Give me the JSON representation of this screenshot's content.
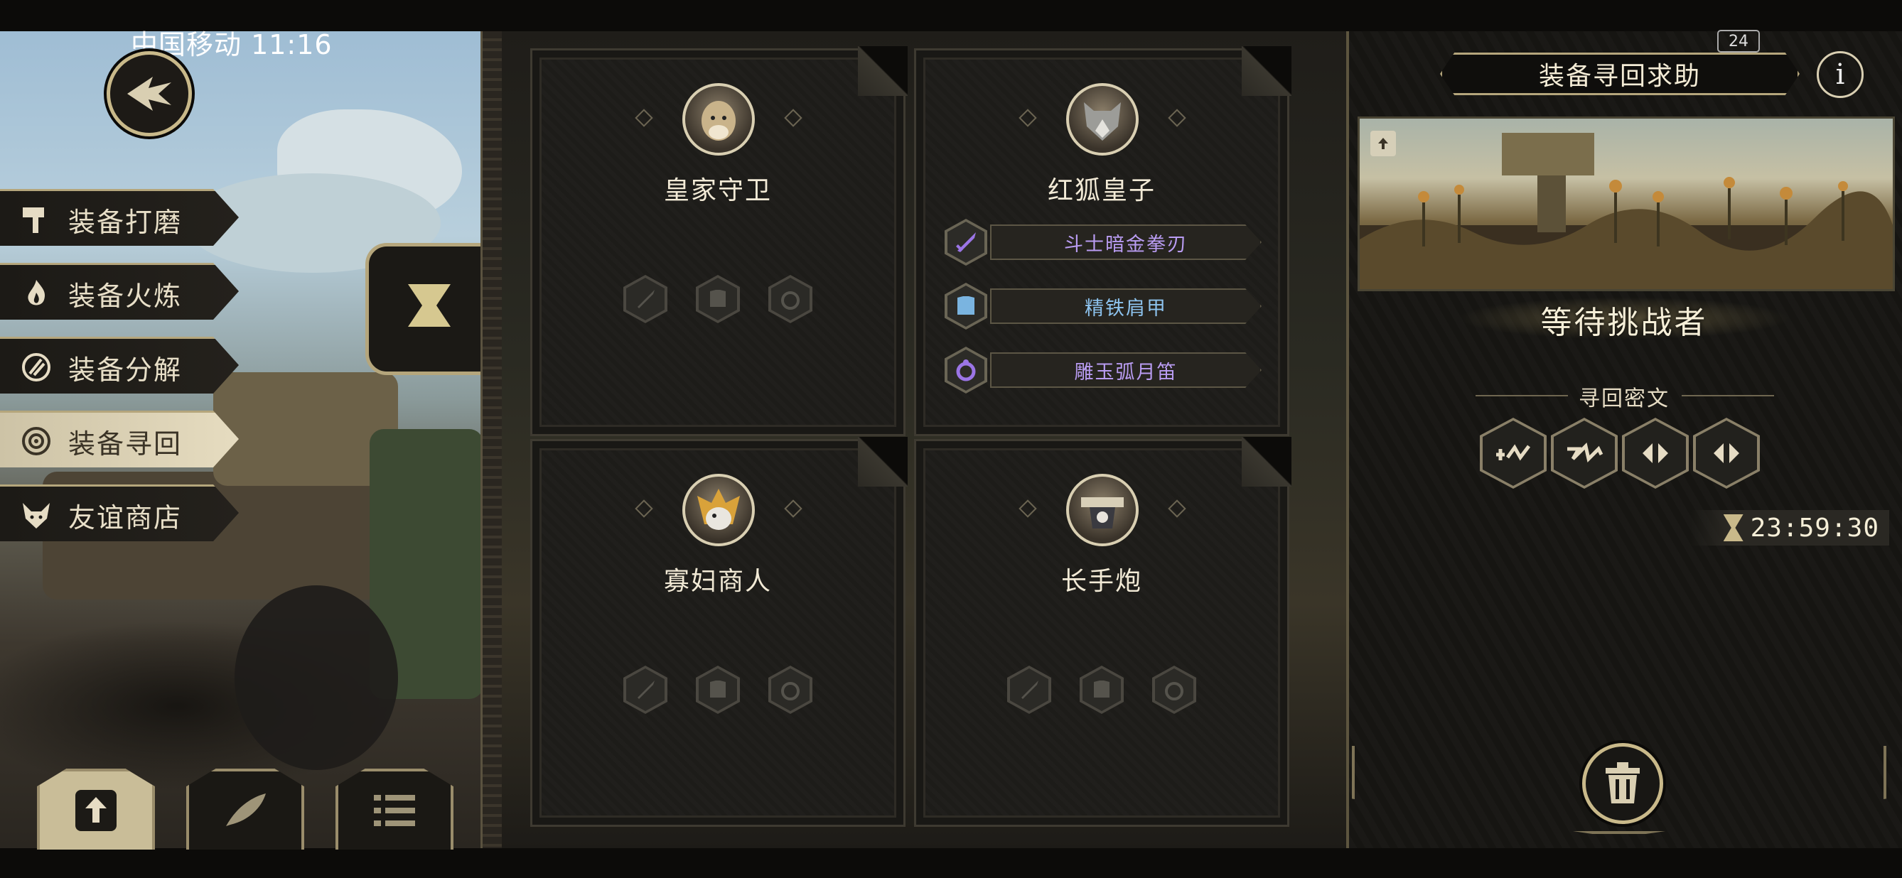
{
  "status_bar": {
    "carrier_time": "中国移动 11:16",
    "battery": "24"
  },
  "left_menu": {
    "items": [
      {
        "label": "装备打磨",
        "icon": "hammer-icon",
        "active": false
      },
      {
        "label": "装备火炼",
        "icon": "flame-icon",
        "active": false
      },
      {
        "label": "装备分解",
        "icon": "disassemble-icon",
        "active": false
      },
      {
        "label": "装备寻回",
        "icon": "target-icon",
        "active": true
      },
      {
        "label": "友谊商店",
        "icon": "fox-icon",
        "active": false
      }
    ]
  },
  "bottom_bar": {
    "buttons": [
      {
        "icon": "upload-icon",
        "active": true
      },
      {
        "icon": "feather-icon",
        "active": false
      },
      {
        "icon": "list-icon",
        "active": false
      }
    ]
  },
  "cards": [
    {
      "name": "皇家守卫",
      "equipment": []
    },
    {
      "name": "红狐皇子",
      "equipment": [
        {
          "label": "斗士暗金拳刃",
          "icon": "sword-icon",
          "color": "#b99cf2"
        },
        {
          "label": "精铁肩甲",
          "icon": "armor-icon",
          "color": "#8dc3ee"
        },
        {
          "label": "雕玉弧月笛",
          "icon": "ring-icon",
          "color": "#b99cf2"
        }
      ]
    },
    {
      "name": "寡妇商人",
      "equipment": []
    },
    {
      "name": "长手炮",
      "equipment": []
    }
  ],
  "right_panel": {
    "title": "装备寻回求助",
    "info_symbol": "i",
    "waiting_title": "等待挑战者",
    "cipher_label": "寻回密文",
    "cipher_runes": [
      "rune-1-icon",
      "rune-2-icon",
      "rune-3-icon",
      "rune-3-icon"
    ],
    "timer": "23:59:30"
  },
  "colors": {
    "accent_gold": "#c9b98a",
    "purple_item": "#b99cf2",
    "blue_item": "#8dc3ee"
  }
}
